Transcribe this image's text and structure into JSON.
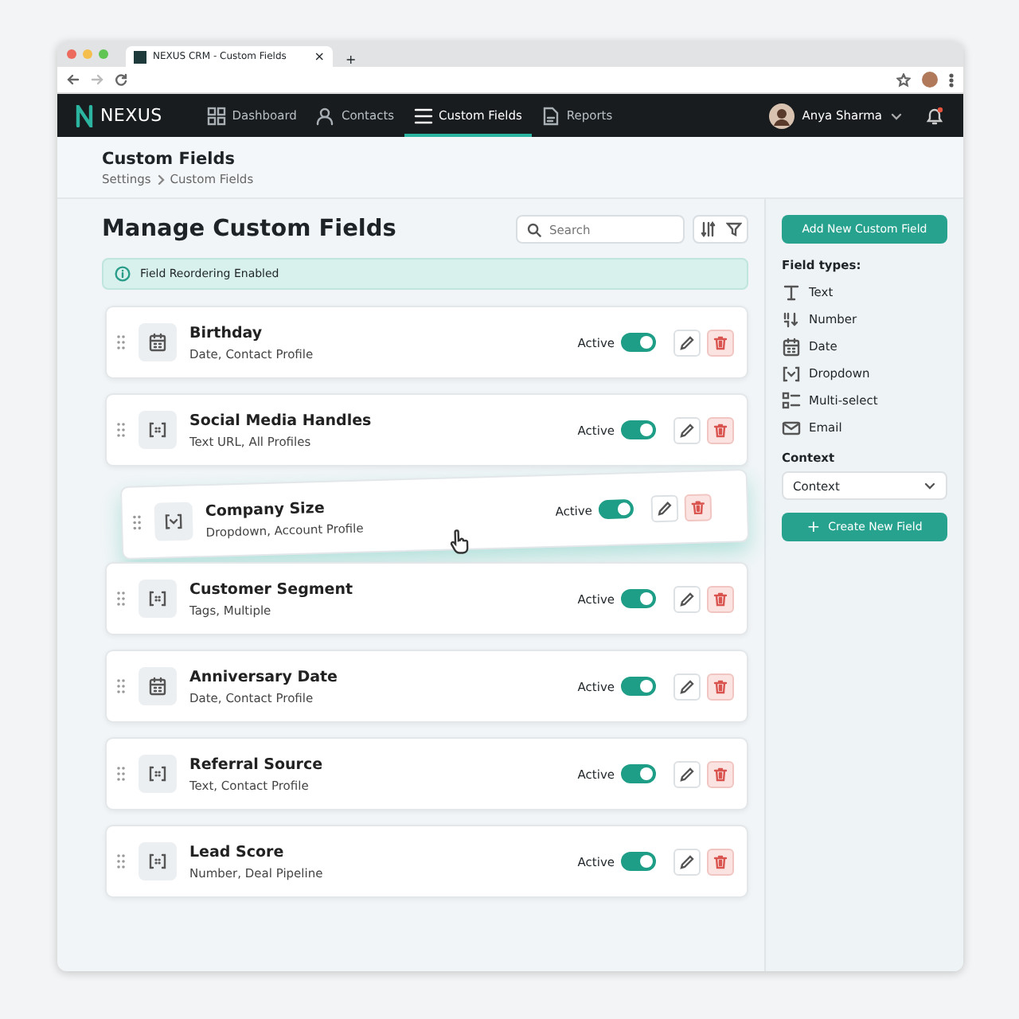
{
  "browser": {
    "tab_title": "NEXUS CRM - Custom Fields",
    "tab_close": "×",
    "new_tab": "+"
  },
  "nav": {
    "brand": "NEXUS",
    "items": [
      {
        "label": "Dashboard",
        "kind": "grid",
        "selected": false
      },
      {
        "label": "Contacts",
        "kind": "person",
        "selected": false
      },
      {
        "label": "Custom Fields",
        "kind": "list",
        "selected": true
      },
      {
        "label": "Reports",
        "kind": "doc",
        "selected": false
      }
    ],
    "user": "Anya Sharma",
    "notification": true
  },
  "header": {
    "title": "Custom Fields",
    "breadcrumb": [
      "Settings",
      "Custom Fields"
    ]
  },
  "main": {
    "title": "Manage Custom Fields",
    "search": {
      "placeholder": "Search"
    },
    "notice": "Field Reordering Enabled"
  },
  "fields": [
    {
      "name": "Birthday",
      "detail": "Date, Contact Profile",
      "kind": "date",
      "status": "Active",
      "on": true,
      "dragging": false
    },
    {
      "name": "Social Media Handles",
      "detail": "Text URL, All Profiles",
      "kind": "bracket",
      "status": "Active",
      "on": true,
      "dragging": false
    },
    {
      "name": "Company Size",
      "detail": "Dropdown, Account Profile",
      "kind": "dropdown",
      "status": "Active",
      "on": true,
      "dragging": true
    },
    {
      "name": "Customer Segment",
      "detail": "Tags, Multiple",
      "kind": "bracket",
      "status": "Active",
      "on": true,
      "dragging": false
    },
    {
      "name": "Anniversary Date",
      "detail": "Date, Contact Profile",
      "kind": "date",
      "status": "Active",
      "on": true,
      "dragging": false
    },
    {
      "name": "Referral Source",
      "detail": "Text, Contact Profile",
      "kind": "bracket",
      "status": "Active",
      "on": true,
      "dragging": false
    },
    {
      "name": "Lead Score",
      "detail": "Number, Deal Pipeline",
      "kind": "bracket",
      "status": "Active",
      "on": true,
      "dragging": false
    }
  ],
  "sidebar": {
    "add_button": "Add New Custom Field",
    "types_title": "Field types:",
    "types": [
      {
        "label": "Text",
        "kind": "text"
      },
      {
        "label": "Number",
        "kind": "number"
      },
      {
        "label": "Date",
        "kind": "date"
      },
      {
        "label": "Dropdown",
        "kind": "dropdown"
      },
      {
        "label": "Multi-select",
        "kind": "multi"
      },
      {
        "label": "Email",
        "kind": "email"
      }
    ],
    "context_label": "Context",
    "context_value": "Context",
    "create_icon": "+",
    "create_button": "Create New Field"
  }
}
